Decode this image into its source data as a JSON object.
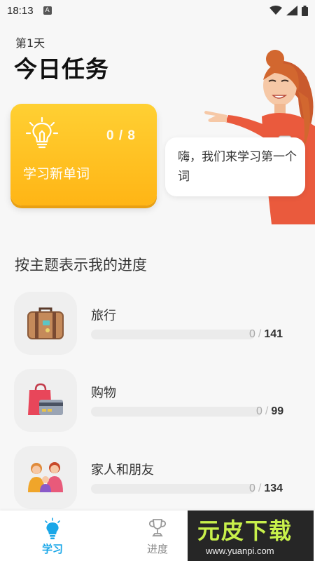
{
  "status_bar": {
    "time": "18:13",
    "notice_icon": "A"
  },
  "header": {
    "day": "第1天",
    "title": "今日任务"
  },
  "task_card": {
    "count": "0 / 8",
    "label": "学习新单词",
    "icon": "lightbulb-icon"
  },
  "bubble": {
    "text": "嗨，我们来学习第一个词"
  },
  "section": {
    "title": "按主题表示我的进度"
  },
  "topics": [
    {
      "name": "旅行",
      "done": "0",
      "separator": "/",
      "total": "141",
      "progress": 0,
      "icon": "suitcase-icon"
    },
    {
      "name": "购物",
      "done": "0",
      "separator": "/",
      "total": "99",
      "progress": 0,
      "icon": "shopping-bag-icon"
    },
    {
      "name": "家人和朋友",
      "done": "0",
      "separator": "/",
      "total": "134",
      "progress": 0,
      "icon": "family-icon"
    }
  ],
  "tabs": [
    {
      "label": "学习",
      "icon": "lightbulb-icon",
      "active": true
    },
    {
      "label": "进度",
      "icon": "trophy-icon",
      "active": false
    }
  ],
  "watermark": {
    "title": "元皮下载",
    "url": "www.yuanpi.com"
  },
  "colors": {
    "accent": "#ffc020",
    "tab_active": "#1aa7e8"
  }
}
